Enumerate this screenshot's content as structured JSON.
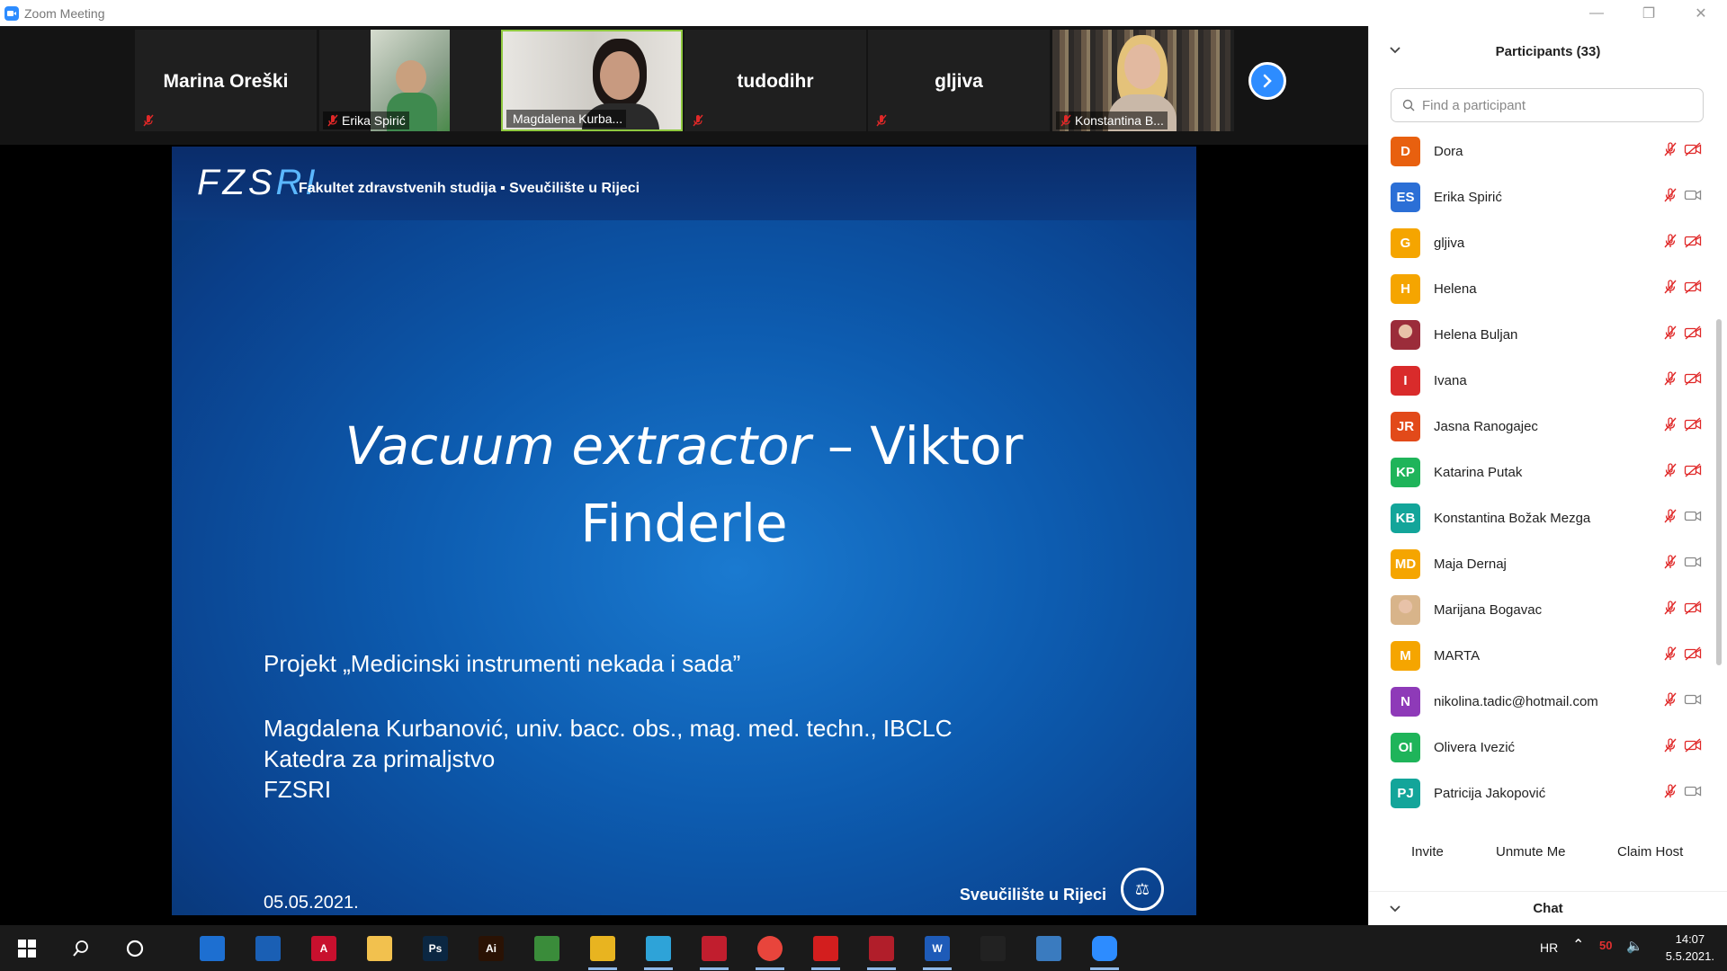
{
  "window": {
    "title": "Zoom Meeting"
  },
  "video_strip": {
    "tiles": [
      {
        "name": "Marina Oreški"
      },
      {
        "label": "Erika Spirić"
      },
      {
        "label": "Magdalena Kurba..."
      },
      {
        "name": "tudodihr"
      },
      {
        "name": "gljiva"
      },
      {
        "label": "Konstantina B..."
      }
    ]
  },
  "slide": {
    "logo": "FZS",
    "logo_accent": "RI",
    "faculty": "Fakultet  zdravstvenih studija ▪ Sveučilište u Rijeci",
    "title_italic": "Vacuum extractor",
    "title_rest": " – Viktor Finderle",
    "project": "Projekt „Medicinski instrumenti nekada i sada”",
    "author_line1": "Magdalena Kurbanović, univ. bacc. obs., mag. med. techn., IBCLC",
    "author_line2": "Katedra za primaljstvo",
    "author_line3": "FZSRI",
    "date": "05.05.2021.",
    "university": "Sveučilište u Rijeci"
  },
  "participants_panel": {
    "title": "Participants (33)",
    "search_placeholder": "Find a participant",
    "list": [
      {
        "initials": "D",
        "name": "Dora",
        "color": "#e8600f",
        "video_off": true
      },
      {
        "initials": "ES",
        "name": "Erika Spirić",
        "color": "#2b6fd6",
        "video_off": false
      },
      {
        "initials": "G",
        "name": "gljiva",
        "color": "#f5a500",
        "video_off": true
      },
      {
        "initials": "H",
        "name": "Helena",
        "color": "#f5a500",
        "video_off": true
      },
      {
        "initials": "",
        "name": "Helena Buljan",
        "color": "#9b2c3a",
        "video_off": true,
        "photo": true
      },
      {
        "initials": "I",
        "name": "Ivana",
        "color": "#d92b2b",
        "video_off": true
      },
      {
        "initials": "JR",
        "name": "Jasna Ranogajec",
        "color": "#e24a1a",
        "video_off": true
      },
      {
        "initials": "KP",
        "name": "Katarina Putak",
        "color": "#1fb45a",
        "video_off": true
      },
      {
        "initials": "KB",
        "name": "Konstantina Božak Mezga",
        "color": "#13a59a",
        "video_off": false
      },
      {
        "initials": "MD",
        "name": "Maja Dernaj",
        "color": "#f5a500",
        "video_off": false
      },
      {
        "initials": "",
        "name": "Marijana Bogavac",
        "color": "#d8b48a",
        "video_off": true,
        "photo": true
      },
      {
        "initials": "M",
        "name": "MARTA",
        "color": "#f5a500",
        "video_off": true
      },
      {
        "initials": "N",
        "name": "nikolina.tadic@hotmail.com",
        "color": "#8e3ab8",
        "video_off": false
      },
      {
        "initials": "OI",
        "name": "Olivera Ivezić",
        "color": "#1fb45a",
        "video_off": true
      },
      {
        "initials": "PJ",
        "name": "Patricija Jakopović",
        "color": "#13a59a",
        "video_off": false
      }
    ],
    "actions": {
      "invite": "Invite",
      "unmute_me": "Unmute Me",
      "claim_host": "Claim Host"
    },
    "chat_title": "Chat"
  },
  "taskbar": {
    "apps": [
      {
        "icon": "autodesk-icon",
        "label": "",
        "color": "#1d6fd1"
      },
      {
        "icon": "edge-icon",
        "label": "",
        "color": "#1a5fb4"
      },
      {
        "icon": "autocad-icon",
        "label": "A",
        "color": "#c8102e"
      },
      {
        "icon": "sticky-icon",
        "label": "",
        "color": "#f2c14e"
      },
      {
        "icon": "photoshop-icon",
        "label": "Ps",
        "color": "#0b2742"
      },
      {
        "icon": "illustrator-icon",
        "label": "Ai",
        "color": "#2a1204"
      },
      {
        "icon": "geogebra-icon",
        "label": "",
        "color": "#3a8c3a"
      },
      {
        "icon": "explorer-icon",
        "label": "",
        "color": "#e8b420"
      },
      {
        "icon": "kodi-icon",
        "label": "",
        "color": "#2ea3d8"
      },
      {
        "icon": "davinci-icon",
        "label": "",
        "color": "#c11e2e"
      },
      {
        "icon": "chrome-icon",
        "label": "",
        "color": "#e8453c"
      },
      {
        "icon": "acrobat-icon",
        "label": "",
        "color": "#d31e1e"
      },
      {
        "icon": "mendeley-icon",
        "label": "",
        "color": "#b11e2a"
      },
      {
        "icon": "word-icon",
        "label": "W",
        "color": "#1e5bb8"
      },
      {
        "icon": "obs-icon",
        "label": "",
        "color": "#222222"
      },
      {
        "icon": "photos-icon",
        "label": "",
        "color": "#3a7bbf"
      },
      {
        "icon": "zoom-icon",
        "label": "",
        "color": "#2d8cff"
      }
    ],
    "language": "HR",
    "time": "14:07",
    "date": "5.5.2021."
  }
}
